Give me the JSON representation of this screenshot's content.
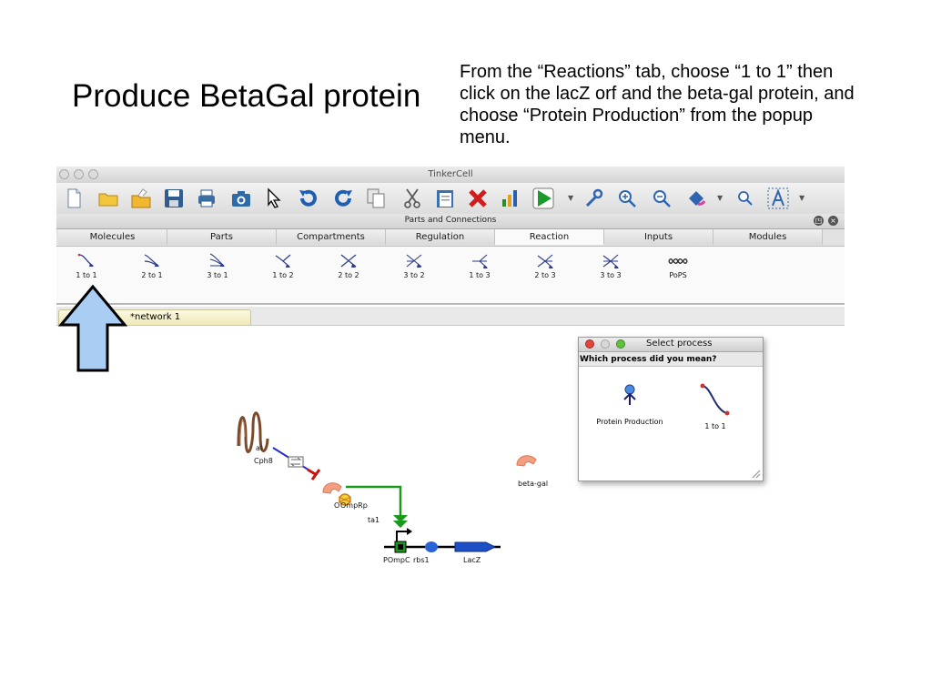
{
  "slide": {
    "title": "Produce BetaGal protein",
    "instructions": "From the “Reactions” tab, choose “1 to 1” then click on the lacZ orf and the beta-gal protein, and choose “Protein Production” from the popup menu."
  },
  "window": {
    "title": "TinkerCell"
  },
  "toolbar": {
    "icons": [
      "new-file-icon",
      "open-folder-icon",
      "open-recent-icon",
      "save-icon",
      "print-icon",
      "screenshot-icon",
      "pointer-icon",
      "undo-icon",
      "redo-icon",
      "copy-icon",
      "cut-icon",
      "paste-icon",
      "delete-icon",
      "plot-icon",
      "play-icon",
      "wrench-icon",
      "zoom-in-icon",
      "zoom-out-icon",
      "fill-color-icon",
      "find-icon",
      "text-icon"
    ]
  },
  "panel": {
    "title": "Parts and Connections",
    "tabs": [
      "Molecules",
      "Parts",
      "Compartments",
      "Regulation",
      "Reaction",
      "Inputs",
      "Modules"
    ],
    "active_tab": "Reaction",
    "reactions": [
      "1 to 1",
      "2 to 1",
      "3 to 1",
      "1 to 2",
      "2 to 2",
      "3 to 2",
      "1 to 3",
      "2 to 3",
      "3 to 3",
      "PoPS"
    ]
  },
  "document_tab": {
    "label": "*network 1"
  },
  "network": {
    "labels": {
      "cph8_partial": "al",
      "cph8": "Cph8",
      "ompr": "OmpRp",
      "ompr_prefix": "O",
      "transcription": "ta1",
      "pompc": "POmpC",
      "rbs": "rbs1",
      "lacz": "LacZ",
      "betagal": "beta-gal"
    }
  },
  "dialog": {
    "title": "Select process",
    "question": "Which process did you mean?",
    "options": [
      "Protein Production",
      "1 to 1"
    ]
  },
  "colors": {
    "highlight_arrow": "#a9cdf3",
    "regulation_green": "#1a9a1a",
    "inhibition_red": "#cc1111",
    "protein_orange": "#f4a080",
    "lacz_blue": "#1f4fc4"
  }
}
